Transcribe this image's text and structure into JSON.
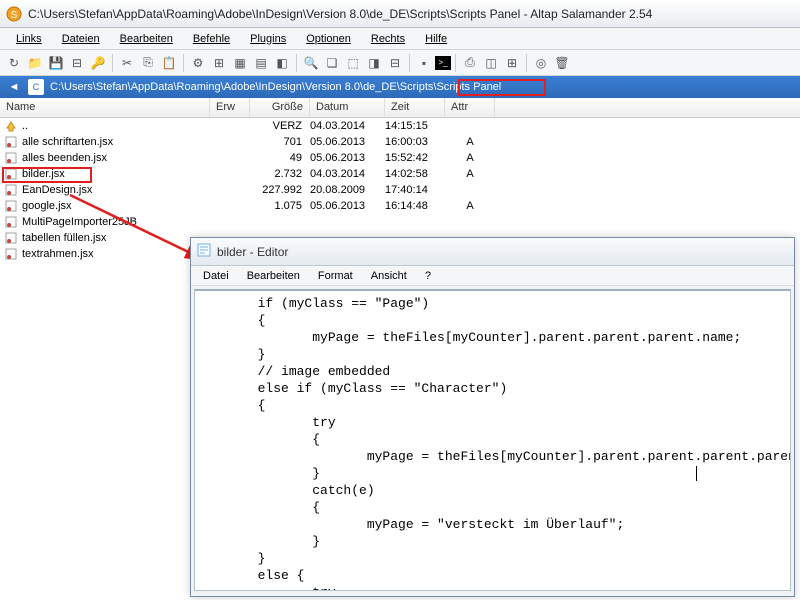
{
  "window": {
    "title": "C:\\Users\\Stefan\\AppData\\Roaming\\Adobe\\InDesign\\Version 8.0\\de_DE\\Scripts\\Scripts Panel - Altap Salamander 2.54"
  },
  "menu": {
    "links": "Links",
    "dateien": "Dateien",
    "bearbeiten": "Bearbeiten",
    "befehle": "Befehle",
    "plugins": "Plugins",
    "optionen": "Optionen",
    "rechts": "Rechts",
    "hilfe": "Hilfe"
  },
  "path": {
    "full": "C:\\Users\\Stefan\\AppData\\Roaming\\Adobe\\InDesign\\Version 8.0\\de_DE\\Scripts\\",
    "highlight": "Scripts Panel"
  },
  "columns": {
    "name": "Name",
    "erw": "Erw",
    "groesse": "Größe",
    "datum": "Datum",
    "zeit": "Zeit",
    "attr": "Attr"
  },
  "files": [
    {
      "icon": "up",
      "name": "..",
      "ext": "",
      "size": "VERZ",
      "date": "04.03.2014",
      "time": "14:15:15",
      "attr": ""
    },
    {
      "icon": "jsx",
      "name": "alle schriftarten.jsx",
      "ext": "",
      "size": "701",
      "date": "05.06.2013",
      "time": "16:00:03",
      "attr": "A"
    },
    {
      "icon": "jsx",
      "name": "alles beenden.jsx",
      "ext": "",
      "size": "49",
      "date": "05.06.2013",
      "time": "15:52:42",
      "attr": "A"
    },
    {
      "icon": "jsx",
      "name": "bilder.jsx",
      "ext": "",
      "size": "2.732",
      "date": "04.03.2014",
      "time": "14:02:58",
      "attr": "A"
    },
    {
      "icon": "jsx",
      "name": "EanDesign.jsx",
      "ext": "",
      "size": "227.992",
      "date": "20.08.2009",
      "time": "17:40:14",
      "attr": ""
    },
    {
      "icon": "jsx",
      "name": "google.jsx",
      "ext": "",
      "size": "1.075",
      "date": "05.06.2013",
      "time": "16:14:48",
      "attr": "A"
    },
    {
      "icon": "jsx",
      "name": "MultiPageImporter25JB",
      "ext": "",
      "size": "",
      "date": "",
      "time": "",
      "attr": ""
    },
    {
      "icon": "jsx",
      "name": "tabellen füllen.jsx",
      "ext": "",
      "size": "",
      "date": "",
      "time": "",
      "attr": ""
    },
    {
      "icon": "jsx",
      "name": "textrahmen.jsx",
      "ext": "",
      "size": "",
      "date": "",
      "time": "",
      "attr": ""
    }
  ],
  "editor": {
    "title": "bilder - Editor",
    "menu": {
      "datei": "Datei",
      "bearbeiten": "Bearbeiten",
      "format": "Format",
      "ansicht": "Ansicht",
      "help": "?"
    },
    "code": "       if (myClass == \"Page\")\n       {\n              myPage = theFiles[myCounter].parent.parent.parent.name;\n       }\n       // image embedded\n       else if (myClass == \"Character\")\n       {\n              try\n              {\n                     myPage = theFiles[myCounter].parent.parent.parent.parent\n              }\n              catch(e)\n              {\n                     myPage = \"versteckt im Überlauf\";\n              }\n       }\n       else {\n              try\n              {\n                     // image placed outside the pages\n                     myPage = \"Spread of \" + theFiles[myCounter].parent.paren\n              }\n              catch(e)\n              {"
  }
}
